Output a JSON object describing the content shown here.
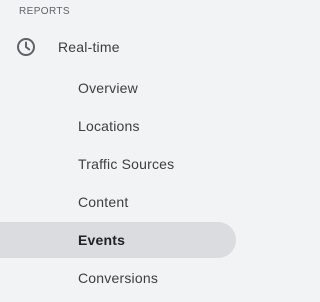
{
  "section": {
    "title": "REPORTS"
  },
  "parent": {
    "label": "Real-time",
    "icon": "clock-icon"
  },
  "items": [
    {
      "label": "Overview"
    },
    {
      "label": "Locations"
    },
    {
      "label": "Traffic Sources"
    },
    {
      "label": "Content"
    },
    {
      "label": "Events",
      "active": true
    },
    {
      "label": "Conversions"
    }
  ],
  "colors": {
    "background": "#f1f3f4",
    "active_background": "#dadce0",
    "text": "#3c4043",
    "muted_text": "#5f6368"
  }
}
